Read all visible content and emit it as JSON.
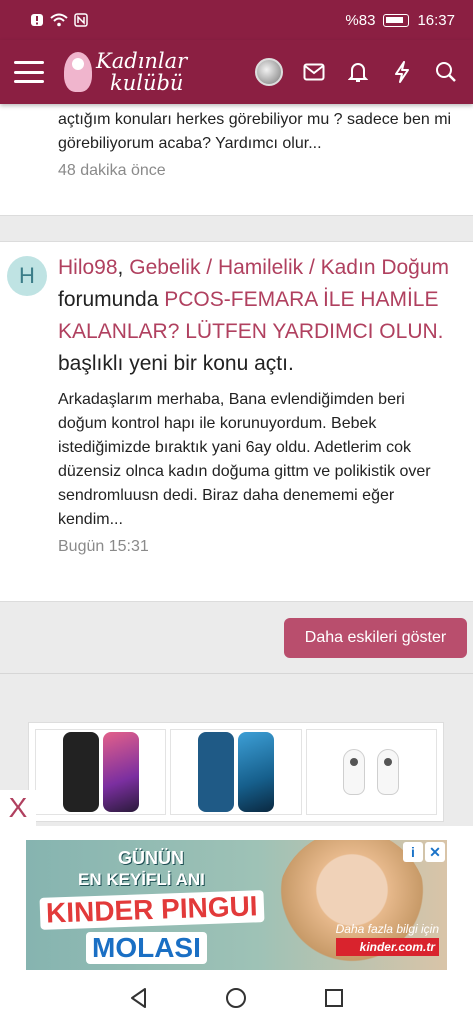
{
  "status_bar": {
    "battery": "%83",
    "time": "16:37"
  },
  "header": {
    "logo_line1": "Kadınlar",
    "logo_line2": "kulübü",
    "brand_color": "#8b1f42"
  },
  "feed": {
    "item1": {
      "cut_text": "…",
      "snippet": "açtığım konuları herkes görebiliyor mu ? sadece ben mi görebiliyorum acaba? Yardımcı olur...",
      "time": "48 dakika önce"
    },
    "item2": {
      "avatar_letter": "H",
      "user": "Hilo98",
      "comma": ",",
      "forum": "Gebelik / Hamilelik / Kadın Doğum",
      "forum_suffix": "forumunda",
      "thread": "PCOS-FEMARA İLE HAMİLE KALANLAR? LÜTFEN YARDIMCI OLUN.",
      "thread_suffix": "başlıklı yeni bir konu açtı.",
      "snippet": "Arkadaşlarım merhaba, Bana evlendiğimden beri doğum kontrol hapı ile korunuyordum. Bebek istediğimizde bıraktık yani 6ay oldu. Adetlerim cok düzensiz olnca kadın doğuma gittm ve polikistik over sendromluusn dedi. Biraz daha denememi eğer kendim...",
      "time": "Bugün 15:31"
    },
    "more_button": "Daha eskileri göster",
    "accent_color": "#b0405f"
  },
  "ad": {
    "close": "X",
    "line1": "GÜNÜN",
    "line2": "EN KEYİFLİ ANI",
    "line3": "KINDER PINGUI",
    "line4": "MOLASI",
    "info": "Daha fazla bilgi için",
    "domain": "kinder.com.tr",
    "choice_info": "i",
    "choice_close": "✕"
  }
}
